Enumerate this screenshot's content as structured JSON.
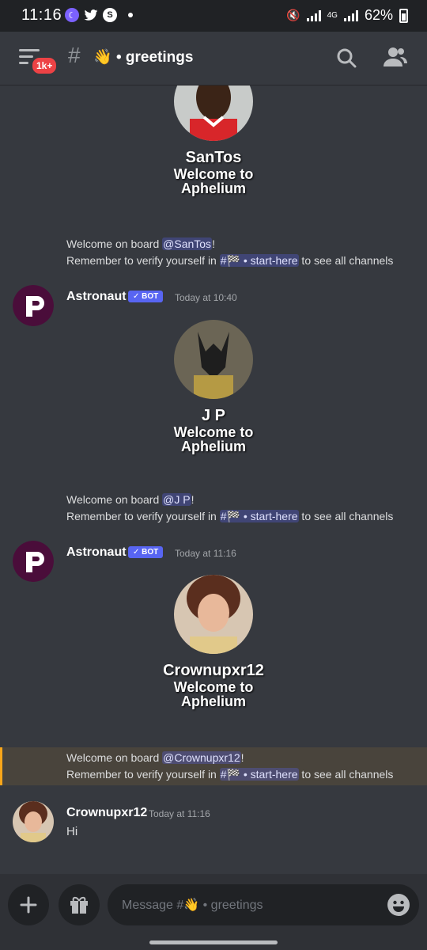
{
  "status_bar": {
    "time": "11:16",
    "network": "4G",
    "battery": "62%"
  },
  "header": {
    "badge": "1k+",
    "channel_emoji": "👋",
    "channel_name": "• greetings"
  },
  "welcome_cards": [
    {
      "name": "SanTos",
      "line1": "Welcome to",
      "line2": "Aphelium"
    },
    {
      "name": "J P",
      "line1": "Welcome to",
      "line2": "Aphelium"
    },
    {
      "name": "Crownupxr12",
      "line1": "Welcome to",
      "line2": "Aphelium"
    }
  ],
  "system_messages": [
    {
      "prefix": "Welcome on board ",
      "mention": "@SanTos",
      "suffix": "!",
      "verify_prefix": "Remember to verify yourself in ",
      "channel_mention": "#🏁 • start-here",
      "verify_suffix": " to see all channels"
    },
    {
      "prefix": "Welcome on board ",
      "mention": "@J P",
      "suffix": "!",
      "verify_prefix": "Remember to verify yourself in ",
      "channel_mention": "#🏁 • start-here",
      "verify_suffix": " to see all channels"
    },
    {
      "prefix": "Welcome on board ",
      "mention": "@Crownupxr12",
      "suffix": "!",
      "verify_prefix": "Remember to verify yourself in ",
      "channel_mention": "#🏁 • start-here",
      "verify_suffix": " to see all channels"
    }
  ],
  "bot_messages": [
    {
      "author": "Astronaut",
      "tag": "✓ BOT",
      "time": "Today at 10:40"
    },
    {
      "author": "Astronaut",
      "tag": "✓ BOT",
      "time": "Today at 11:16"
    }
  ],
  "user_message": {
    "author": "Crownupxr12",
    "time": "Today at 11:16",
    "text": "Hi"
  },
  "composer": {
    "placeholder": "Message #👋 • greetings"
  },
  "colors": {
    "accent": "#5865f2",
    "background": "#36393f",
    "highlight": "#faa61a"
  }
}
